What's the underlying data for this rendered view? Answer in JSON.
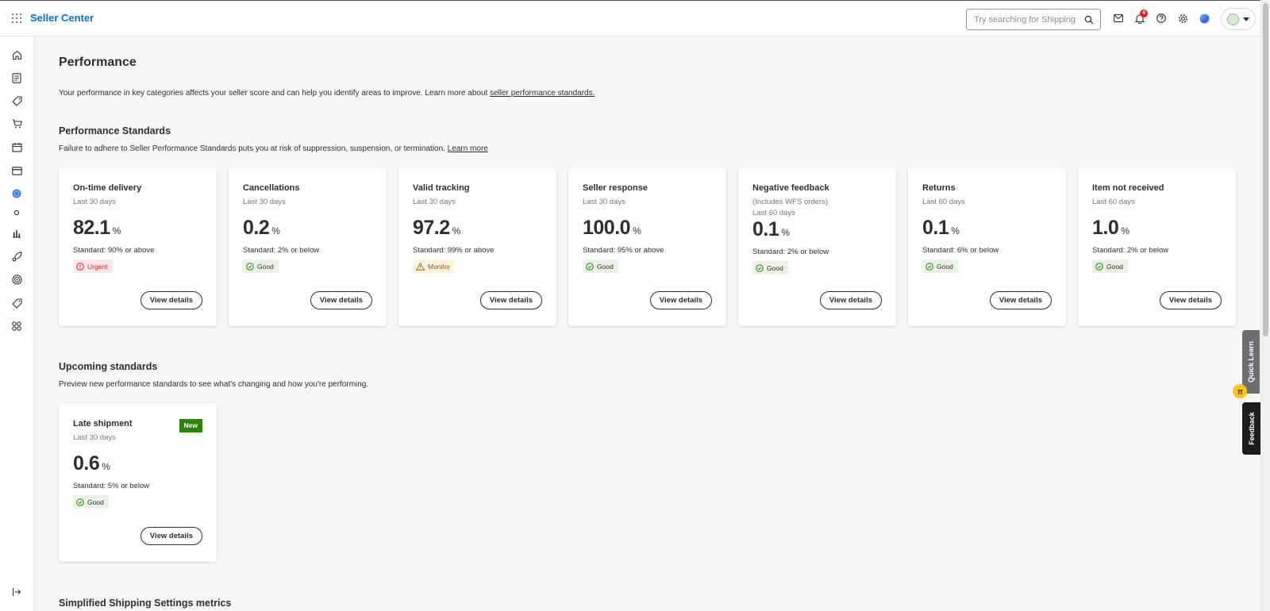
{
  "header": {
    "brand": "Seller Center",
    "search_placeholder": "Try searching for Shipping",
    "notification_count": "4"
  },
  "sidebar": {
    "items": [
      "home-icon",
      "orders-icon",
      "items-icon",
      "cart-icon",
      "inventory-icon",
      "payments-icon",
      "globe-icon",
      "dot-icon",
      "analytics-icon",
      "growth-icon",
      "target-icon",
      "tag-icon",
      "apps-icon",
      "collapse-icon"
    ]
  },
  "page": {
    "title": "Performance",
    "intro_text": "Your performance in key categories affects your seller score and can help you identify areas to improve. Learn more about",
    "intro_link": "seller performance standards."
  },
  "standards": {
    "title": "Performance Standards",
    "subtitle": "Failure to adhere to Seller Performance Standards puts you at risk of suppression, suspension, or termination.",
    "learn_more": "Learn more",
    "cards": [
      {
        "title": "On-time delivery",
        "period": "Last 30 days",
        "period2": "",
        "value": "82.1",
        "unit": "%",
        "standard": "Standard: 90% or above",
        "status": "Urgent",
        "status_type": "urgent",
        "button": "View details"
      },
      {
        "title": "Cancellations",
        "period": "Last 30 days",
        "period2": "",
        "value": "0.2",
        "unit": "%",
        "standard": "Standard: 2% or below",
        "status": "Good",
        "status_type": "good",
        "button": "View details"
      },
      {
        "title": "Valid tracking",
        "period": "Last 30 days",
        "period2": "",
        "value": "97.2",
        "unit": "%",
        "standard": "Standard: 99% or above",
        "status": "Monitor",
        "status_type": "monitor",
        "button": "View details"
      },
      {
        "title": "Seller response",
        "period": "Last 30 days",
        "period2": "",
        "value": "100.0",
        "unit": "%",
        "standard": "Standard: 95% or above",
        "status": "Good",
        "status_type": "good",
        "button": "View details"
      },
      {
        "title": "Negative feedback",
        "period": "(Includes WFS orders)",
        "period2": "Last 60 days",
        "value": "0.1",
        "unit": "%",
        "standard": "Standard: 2% or below",
        "status": "Good",
        "status_type": "good",
        "button": "View details"
      },
      {
        "title": "Returns",
        "period": "Last 60 days",
        "period2": "",
        "value": "0.1",
        "unit": "%",
        "standard": "Standard: 6% or below",
        "status": "Good",
        "status_type": "good",
        "button": "View details"
      },
      {
        "title": "Item not received",
        "period": "Last 60 days",
        "period2": "",
        "value": "1.0",
        "unit": "%",
        "standard": "Standard: 2% or below",
        "status": "Good",
        "status_type": "good",
        "button": "View details"
      }
    ]
  },
  "upcoming": {
    "title": "Upcoming standards",
    "subtitle": "Preview new performance standards to see what's changing and how you're performing.",
    "card": {
      "title": "Late shipment",
      "badge": "New",
      "period": "Last 30 days",
      "value": "0.6",
      "unit": "%",
      "standard": "Standard: 5% or below",
      "status": "Good",
      "status_type": "good",
      "button": "View details"
    }
  },
  "sss": {
    "title": "Simplified Shipping Settings metrics"
  },
  "floating": {
    "quick_learn": "Quick Learn",
    "feedback": "Feedback"
  },
  "colors": {
    "brand": "#0071dc",
    "good": "#2a8703",
    "urgent": "#de1c24",
    "monitor": "#b36a16"
  }
}
